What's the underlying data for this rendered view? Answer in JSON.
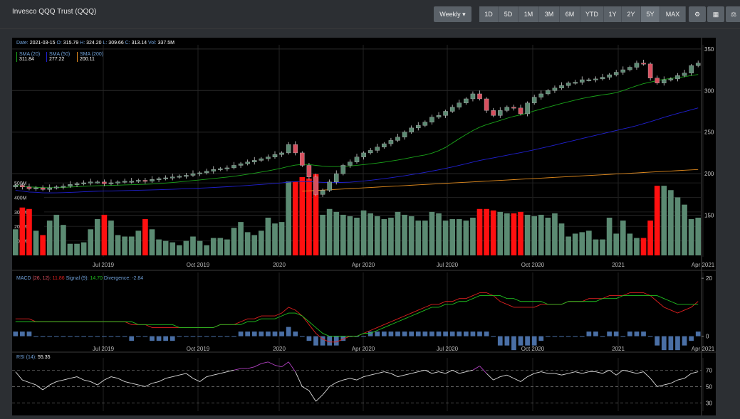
{
  "header": {
    "title": "Invesco QQQ Trust (QQQ)",
    "interval": "Weekly",
    "ranges": [
      "1D",
      "5D",
      "1M",
      "3M",
      "6M",
      "YTD",
      "1Y",
      "2Y",
      "5Y",
      "MAX"
    ],
    "active_range": "5Y"
  },
  "colors": {
    "up": "#5b8a72",
    "down": "#d8505f",
    "sma20": "#1aa31a",
    "sma50": "#2020d0",
    "sma200": "#e08a1e",
    "macd": "#e02020",
    "signal": "#20c020",
    "hist": "#4a6fa5",
    "rsi": "#dddddd",
    "rsi_hi": "#b040c0"
  },
  "ohlc_header": {
    "date_label": "Date:",
    "date": "2021-03-15",
    "o_label": "O:",
    "o": "315.79",
    "h_label": "H:",
    "h": "324.20",
    "l_label": "L:",
    "l": "309.66",
    "c_label": "C:",
    "c": "313.14",
    "vol_label": "Vol:",
    "vol": "337.5M"
  },
  "sma_legend": [
    {
      "label": "SMA (20)",
      "value": "311.84"
    },
    {
      "label": "SMA (50)",
      "value": "277.22"
    },
    {
      "label": "SMA (200)",
      "value": "200.11"
    }
  ],
  "macd_legend": {
    "label": "MACD",
    "params": "(26, 12):",
    "macd_value": "11.86",
    "signal_label": "Signal (9):",
    "signal_value": "14.70",
    "div_label": "Divergence:",
    "div_value": "-2.84"
  },
  "rsi_legend": {
    "label": "RSI (14):",
    "value": "55.35"
  },
  "chart_data": [
    {
      "type": "candlestick",
      "title": "",
      "x_tick_labels": [
        "Jul 2019",
        "Oct 2019",
        "2020",
        "Apr 2020",
        "Jul 2020",
        "Oct 2020",
        "2021",
        "Apr 2021"
      ],
      "y_ticks": [
        150,
        200,
        250,
        300,
        350
      ],
      "ylim": [
        100,
        355
      ],
      "close": [
        186,
        184,
        182,
        183,
        181,
        183,
        184,
        185,
        187,
        188,
        189,
        190,
        190,
        188,
        189,
        190,
        191,
        191,
        192,
        191,
        193,
        194,
        195,
        196,
        197,
        198,
        200,
        201,
        203,
        205,
        206,
        207,
        210,
        212,
        214,
        216,
        218,
        220,
        223,
        225,
        235,
        225,
        210,
        196,
        175,
        180,
        190,
        200,
        210,
        214,
        220,
        225,
        228,
        232,
        236,
        240,
        244,
        250,
        255,
        258,
        262,
        268,
        270,
        275,
        280,
        285,
        290,
        296,
        290,
        276,
        270,
        276,
        280,
        279,
        272,
        285,
        292,
        296,
        300,
        303,
        306,
        309,
        310,
        313,
        313,
        314,
        316,
        319,
        322,
        325,
        328,
        333,
        332,
        315,
        309,
        313,
        314,
        318,
        321,
        330,
        333
      ],
      "volume_axis": {
        "ticks": [
          "100M",
          "200M",
          "300M",
          "400M",
          "500M"
        ]
      },
      "volume": [
        180,
        330,
        320,
        170,
        140,
        240,
        280,
        210,
        80,
        80,
        90,
        180,
        250,
        280,
        240,
        140,
        130,
        130,
        170,
        250,
        180,
        110,
        100,
        90,
        70,
        100,
        130,
        100,
        70,
        120,
        120,
        110,
        190,
        230,
        160,
        140,
        170,
        260,
        220,
        230,
        510,
        510,
        540,
        530,
        560,
        280,
        320,
        300,
        280,
        270,
        260,
        310,
        290,
        270,
        250,
        260,
        300,
        280,
        270,
        240,
        240,
        300,
        290,
        240,
        250,
        250,
        240,
        260,
        320,
        320,
        310,
        300,
        290,
        290,
        300,
        280,
        270,
        280,
        260,
        290,
        220,
        130,
        150,
        160,
        170,
        110,
        110,
        260,
        150,
        240,
        150,
        120,
        120,
        240,
        480,
        480,
        450,
        400,
        350,
        250,
        260
      ]
    },
    {
      "type": "line",
      "title": "MACD",
      "y_ticks": [
        0,
        20
      ],
      "ylim": [
        -5,
        22
      ],
      "series": [
        {
          "name": "MACD",
          "values": [
            6,
            6,
            6,
            5,
            5,
            5,
            5,
            5,
            5,
            5,
            5,
            5,
            5,
            5,
            5,
            5,
            5,
            4,
            4,
            4,
            3,
            3,
            3,
            3,
            3,
            3,
            3,
            3,
            3,
            3,
            4,
            4,
            4,
            5,
            6,
            6,
            7,
            7,
            7,
            8,
            10,
            9,
            7,
            4,
            1,
            -1,
            -2,
            -2,
            -1,
            0,
            0,
            1,
            2,
            3,
            4,
            5,
            6,
            7,
            8,
            9,
            10,
            11,
            11,
            12,
            12,
            13,
            13,
            14,
            15,
            15,
            14,
            12,
            11,
            10,
            10,
            10,
            10,
            11,
            11,
            11,
            11,
            12,
            12,
            12,
            13,
            13,
            13,
            14,
            14,
            14,
            15,
            15,
            15,
            14,
            12,
            10,
            9,
            8,
            9,
            10,
            12
          ]
        },
        {
          "name": "Signal",
          "values": [
            5,
            5,
            5,
            5,
            5,
            5,
            5,
            5,
            5,
            5,
            5,
            5,
            5,
            5,
            5,
            5,
            5,
            5,
            4,
            4,
            4,
            4,
            4,
            4,
            3,
            3,
            3,
            3,
            3,
            3,
            4,
            4,
            4,
            4,
            5,
            5,
            6,
            6,
            6,
            7,
            8,
            8,
            7,
            5,
            3,
            1,
            0,
            0,
            0,
            0,
            0,
            1,
            1,
            2,
            3,
            4,
            5,
            6,
            7,
            8,
            9,
            10,
            10,
            11,
            11,
            12,
            12,
            13,
            14,
            14,
            14,
            14,
            13,
            13,
            12,
            12,
            12,
            12,
            11,
            11,
            11,
            12,
            12,
            12,
            12,
            12,
            13,
            13,
            13,
            14,
            14,
            14,
            14,
            14,
            14,
            13,
            12,
            11,
            11,
            11,
            11
          ]
        },
        {
          "name": "Divergence",
          "values": [
            1,
            1,
            1,
            0,
            0,
            0,
            0,
            0,
            0,
            0,
            0,
            0,
            0,
            0,
            0,
            0,
            0,
            -1,
            0,
            0,
            -1,
            -1,
            -1,
            -1,
            0,
            0,
            0,
            0,
            0,
            0,
            0,
            0,
            0,
            1,
            1,
            1,
            1,
            1,
            1,
            1,
            2,
            1,
            0,
            -1,
            -2,
            -2,
            -2,
            -2,
            -1,
            0,
            0,
            0,
            1,
            1,
            1,
            1,
            1,
            1,
            1,
            1,
            1,
            1,
            1,
            1,
            1,
            1,
            1,
            1,
            1,
            1,
            0,
            -2,
            -2,
            -3,
            -2,
            -2,
            -2,
            -1,
            0,
            0,
            0,
            0,
            0,
            0,
            1,
            1,
            0,
            1,
            1,
            0,
            1,
            1,
            1,
            0,
            -2,
            -3,
            -3,
            -3,
            -2,
            -1,
            1
          ]
        }
      ]
    },
    {
      "type": "line",
      "title": "RSI",
      "y_ticks": [
        30,
        50,
        70
      ],
      "ylim": [
        20,
        85
      ],
      "series": [
        {
          "name": "RSI",
          "values": [
            68,
            58,
            55,
            52,
            46,
            52,
            56,
            58,
            60,
            62,
            58,
            56,
            52,
            58,
            62,
            60,
            56,
            54,
            52,
            50,
            54,
            56,
            60,
            62,
            64,
            66,
            60,
            56,
            62,
            64,
            66,
            68,
            70,
            72,
            72,
            74,
            78,
            80,
            76,
            74,
            80,
            68,
            50,
            45,
            32,
            40,
            50,
            55,
            58,
            60,
            58,
            62,
            64,
            66,
            68,
            66,
            62,
            64,
            66,
            68,
            70,
            66,
            68,
            66,
            70,
            66,
            68,
            70,
            75,
            66,
            58,
            62,
            64,
            60,
            56,
            62,
            66,
            68,
            66,
            66,
            64,
            66,
            68,
            66,
            68,
            68,
            66,
            70,
            64,
            70,
            68,
            66,
            68,
            60,
            50,
            52,
            54,
            58,
            60,
            66,
            68
          ]
        }
      ]
    }
  ]
}
